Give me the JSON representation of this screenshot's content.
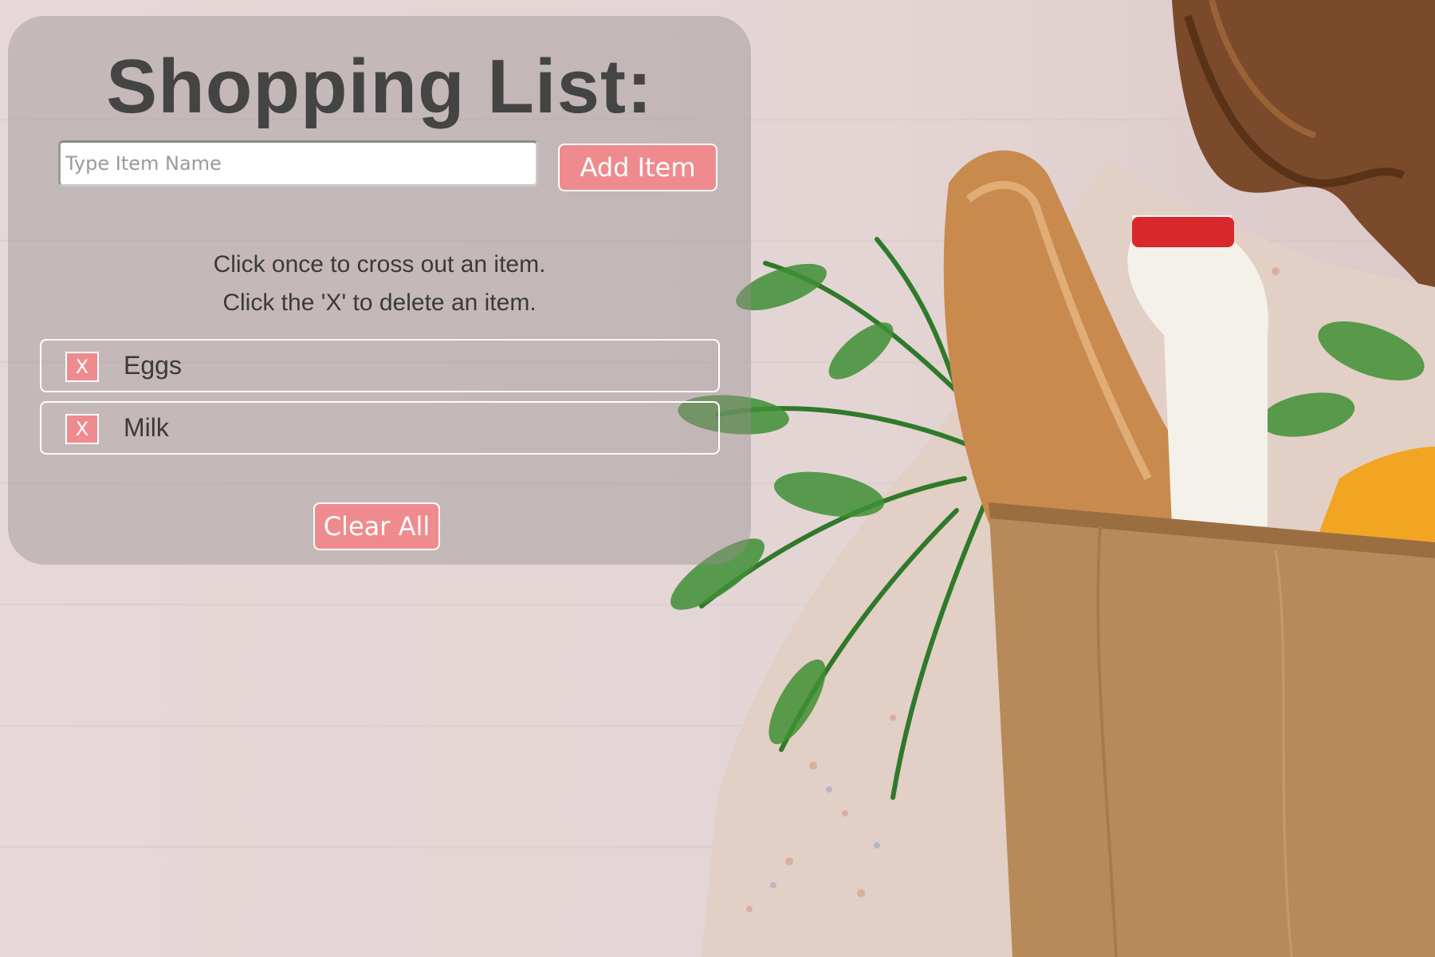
{
  "app": {
    "title": "Shopping List:"
  },
  "input": {
    "placeholder": "Type Item Name",
    "value": ""
  },
  "buttons": {
    "add_label": "Add Item",
    "clear_label": "Clear All"
  },
  "instructions": [
    "Click once to cross out an item.",
    "Click the 'X' to delete an item."
  ],
  "items": [
    {
      "label": "Eggs",
      "delete_label": "X"
    },
    {
      "label": "Milk",
      "delete_label": "X"
    }
  ],
  "colors": {
    "accent": "#ef8b8e",
    "title_text": "#444444",
    "body_text": "#3a3a3a",
    "panel": "rgba(150,140,140,0.42)"
  },
  "background": {
    "description_icon": "grocery-bag-photo"
  }
}
